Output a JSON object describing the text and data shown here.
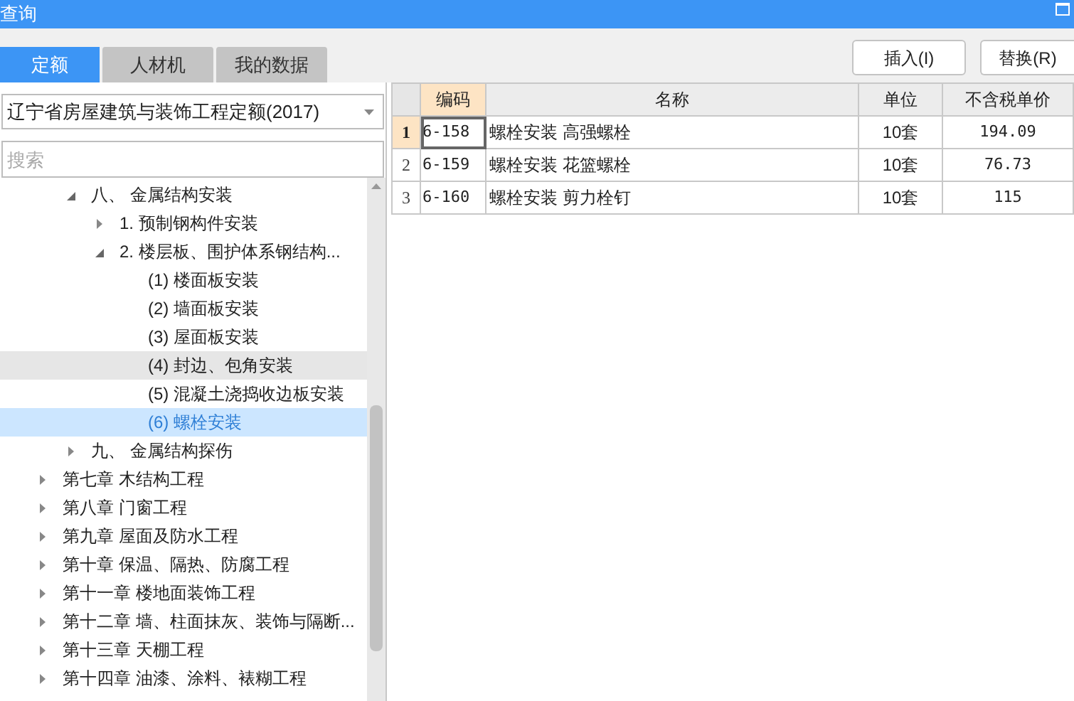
{
  "window": {
    "title": "查询"
  },
  "tabs": [
    {
      "label": "定额",
      "selected": true
    },
    {
      "label": "人材机",
      "selected": false
    },
    {
      "label": "我的数据",
      "selected": false
    }
  ],
  "buttons": [
    "插入(I)",
    "替换(R)"
  ],
  "library_select": {
    "value": "辽宁省房屋建筑与装饰工程定额(2017)"
  },
  "search": {
    "placeholder": "搜索"
  },
  "tree": [
    {
      "children": [
        {
          "label": "八、 金属结构安装",
          "expanded": true,
          "children": [
            {
              "label": "1. 预制钢构件安装",
              "expanded": false
            },
            {
              "label": "2. 楼层板、围护体系钢结构...",
              "expanded": true,
              "children": [
                {
                  "label": "(1) 楼面板安装",
                  "selected": false,
                  "hovered": false
                },
                {
                  "label": "(2) 墙面板安装",
                  "selected": false,
                  "hovered": false
                },
                {
                  "label": "(3) 屋面板安装",
                  "selected": false,
                  "hovered": false
                },
                {
                  "label": "(4) 封边、包角安装",
                  "selected": false,
                  "hovered": true
                },
                {
                  "label": "(5) 混凝土浇捣收边板安装",
                  "selected": false,
                  "hovered": false
                },
                {
                  "label": "(6) 螺栓安装",
                  "selected": true,
                  "hovered": false
                }
              ]
            }
          ]
        },
        {
          "label": "九、 金属结构探伤",
          "expanded": false
        }
      ]
    },
    {
      "label": "第七章 木结构工程",
      "expanded": false
    },
    {
      "label": "第八章 门窗工程",
      "expanded": false
    },
    {
      "label": "第九章 屋面及防水工程",
      "expanded": false
    },
    {
      "label": "第十章 保温、隔热、防腐工程",
      "expanded": false
    },
    {
      "label": "第十一章 楼地面装饰工程",
      "expanded": false
    },
    {
      "label": "第十二章 墙、柱面抹灰、装饰与隔断...",
      "expanded": false
    },
    {
      "label": "第十三章 天棚工程",
      "expanded": false
    },
    {
      "label": "第十四章 油漆、涂料、裱糊工程",
      "expanded": false
    }
  ],
  "table": {
    "columns": [
      "编码",
      "名称",
      "单位",
      "不含税单价"
    ],
    "rows": [
      {
        "index": "1",
        "selected": true,
        "cells": [
          "6-158",
          "螺栓安装 高强螺栓",
          "10套",
          "194.09"
        ]
      },
      {
        "index": "2",
        "selected": false,
        "cells": [
          "6-159",
          "螺栓安装 花篮螺栓",
          "10套",
          "76.73"
        ]
      },
      {
        "index": "3",
        "selected": false,
        "cells": [
          "6-160",
          "螺栓安装 剪力栓钉",
          "10套",
          "115"
        ]
      }
    ]
  }
}
